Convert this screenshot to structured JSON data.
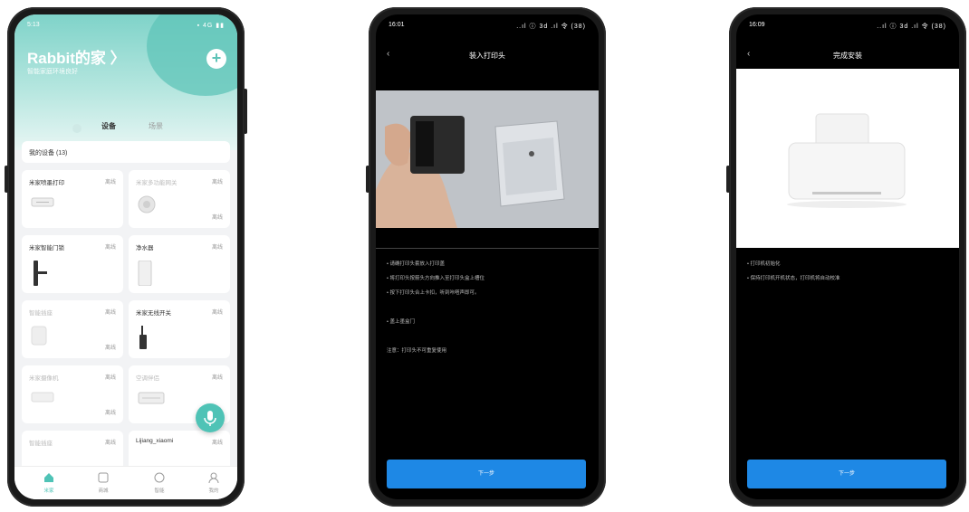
{
  "phone1": {
    "status_time": "5:13",
    "status_icons": "▪ 4G ▮▮",
    "home_title": "Rabbit的家 〉",
    "home_subtitle": "智能家庭环境良好",
    "tabs": [
      {
        "label": "设备"
      },
      {
        "label": "场景"
      }
    ],
    "device_filter": "我的设备 (13)",
    "devices": [
      {
        "name": "米家喷墨打印",
        "status": "离线",
        "note": ""
      },
      {
        "name": "米家多功能网关",
        "status": "离线",
        "note": "离线"
      },
      {
        "name": "米家智能门锁",
        "status": "离线",
        "note": ""
      },
      {
        "name": "净水器",
        "status": "离线",
        "note": ""
      },
      {
        "name": "智能插座",
        "status": "离线",
        "note": "离线"
      },
      {
        "name": "米家无线开关",
        "status": "离线",
        "note": ""
      },
      {
        "name": "米家摄像机",
        "status": "离线",
        "note": "离线"
      },
      {
        "name": "空调伴侣",
        "status": "离线",
        "note": ""
      },
      {
        "name": "智能插座",
        "status": "离线",
        "note": ""
      },
      {
        "name": "Lijiang_xiaomi",
        "status": "离线",
        "note": ""
      }
    ],
    "nav": [
      {
        "label": "米家"
      },
      {
        "label": "商城"
      },
      {
        "label": "智能"
      },
      {
        "label": "我的"
      }
    ],
    "colors": {
      "accent": "#4fc3b6"
    }
  },
  "phone2": {
    "status_time": "16:01",
    "status_icons": "..ıl ⓘ 3d .ıl 令 (38)",
    "title": "装入打印头",
    "steps": [
      "• 请确打印头套放入打印盖",
      "• 将打印头按箭头方向推入至打印头盒上槽位",
      "• 按下打印头合上卡扣，听到咔嗒声即可。",
      "• 盖上墨盒门",
      "注意：打印头不可重复使用"
    ],
    "next_label": "下一步",
    "colors": {
      "button": "#1e88e5"
    }
  },
  "phone3": {
    "status_time": "16:09",
    "status_icons": "..ıl ⓘ 3d .ıl 令 (38)",
    "title": "完成安装",
    "steps": [
      "• 打印机初始化",
      "• 保持打印机开机状态，打印机将自动校准"
    ],
    "next_label": "下一步"
  }
}
